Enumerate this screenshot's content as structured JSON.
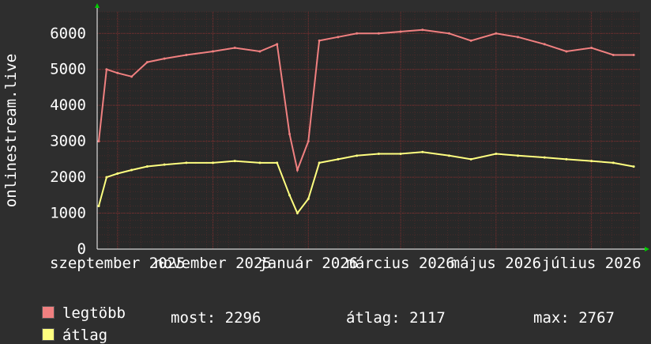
{
  "chart_data": {
    "type": "line",
    "ylabel": "onlinestream.live",
    "ylim": [
      0,
      6600
    ],
    "yticks": [
      0,
      1000,
      2000,
      3000,
      4000,
      5000,
      6000
    ],
    "xlim": [
      "2025-08-19",
      "2026-08-01"
    ],
    "xticks": [
      {
        "label": "szeptember 2025",
        "date": "2025-09-01"
      },
      {
        "label": "november 2025",
        "date": "2025-11-01"
      },
      {
        "label": "január 2026",
        "date": "2026-01-01"
      },
      {
        "label": "március 2026",
        "date": "2026-03-01"
      },
      {
        "label": "május 2026",
        "date": "2026-05-01"
      },
      {
        "label": "július 2026",
        "date": "2026-07-01"
      }
    ],
    "grid": true,
    "series": [
      {
        "name": "legtöbb",
        "color": "#f08080",
        "points": [
          [
            "2025-08-20",
            3000
          ],
          [
            "2025-08-25",
            5000
          ],
          [
            "2025-09-01",
            4900
          ],
          [
            "2025-09-10",
            4800
          ],
          [
            "2025-09-20",
            5200
          ],
          [
            "2025-10-01",
            5300
          ],
          [
            "2025-10-15",
            5400
          ],
          [
            "2025-11-01",
            5500
          ],
          [
            "2025-11-15",
            5600
          ],
          [
            "2025-12-01",
            5500
          ],
          [
            "2025-12-12",
            5700
          ],
          [
            "2025-12-20",
            3200
          ],
          [
            "2025-12-25",
            2200
          ],
          [
            "2026-01-01",
            3000
          ],
          [
            "2026-01-08",
            5800
          ],
          [
            "2026-01-20",
            5900
          ],
          [
            "2026-02-01",
            6000
          ],
          [
            "2026-02-15",
            6000
          ],
          [
            "2026-03-01",
            6050
          ],
          [
            "2026-03-15",
            6100
          ],
          [
            "2026-04-01",
            6000
          ],
          [
            "2026-04-15",
            5800
          ],
          [
            "2026-05-01",
            6000
          ],
          [
            "2026-05-15",
            5900
          ],
          [
            "2026-06-01",
            5700
          ],
          [
            "2026-06-15",
            5500
          ],
          [
            "2026-07-01",
            5600
          ],
          [
            "2026-07-15",
            5400
          ],
          [
            "2026-07-28",
            5400
          ]
        ]
      },
      {
        "name": "átlag",
        "color": "#ffff80",
        "points": [
          [
            "2025-08-20",
            1200
          ],
          [
            "2025-08-25",
            2000
          ],
          [
            "2025-09-01",
            2100
          ],
          [
            "2025-09-10",
            2200
          ],
          [
            "2025-09-20",
            2300
          ],
          [
            "2025-10-01",
            2350
          ],
          [
            "2025-10-15",
            2400
          ],
          [
            "2025-11-01",
            2400
          ],
          [
            "2025-11-15",
            2450
          ],
          [
            "2025-12-01",
            2400
          ],
          [
            "2025-12-12",
            2400
          ],
          [
            "2025-12-20",
            1500
          ],
          [
            "2025-12-25",
            1000
          ],
          [
            "2026-01-01",
            1400
          ],
          [
            "2026-01-08",
            2400
          ],
          [
            "2026-01-20",
            2500
          ],
          [
            "2026-02-01",
            2600
          ],
          [
            "2026-02-15",
            2650
          ],
          [
            "2026-03-01",
            2650
          ],
          [
            "2026-03-15",
            2700
          ],
          [
            "2026-04-01",
            2600
          ],
          [
            "2026-04-15",
            2500
          ],
          [
            "2026-05-01",
            2650
          ],
          [
            "2026-05-15",
            2600
          ],
          [
            "2026-06-01",
            2550
          ],
          [
            "2026-06-15",
            2500
          ],
          [
            "2026-07-01",
            2450
          ],
          [
            "2026-07-15",
            2400
          ],
          [
            "2026-07-28",
            2296
          ]
        ]
      }
    ]
  },
  "legend": {
    "max_label": "legtöbb",
    "avg_label": "átlag",
    "now_text": "most: 2296",
    "avg_text": "átlag: 2117",
    "max_text": "max: 2767"
  },
  "colors": {
    "background": "#2e2e2e",
    "plot_background": "#282828",
    "grid_major": "#803030",
    "axis": "#ffffff"
  }
}
